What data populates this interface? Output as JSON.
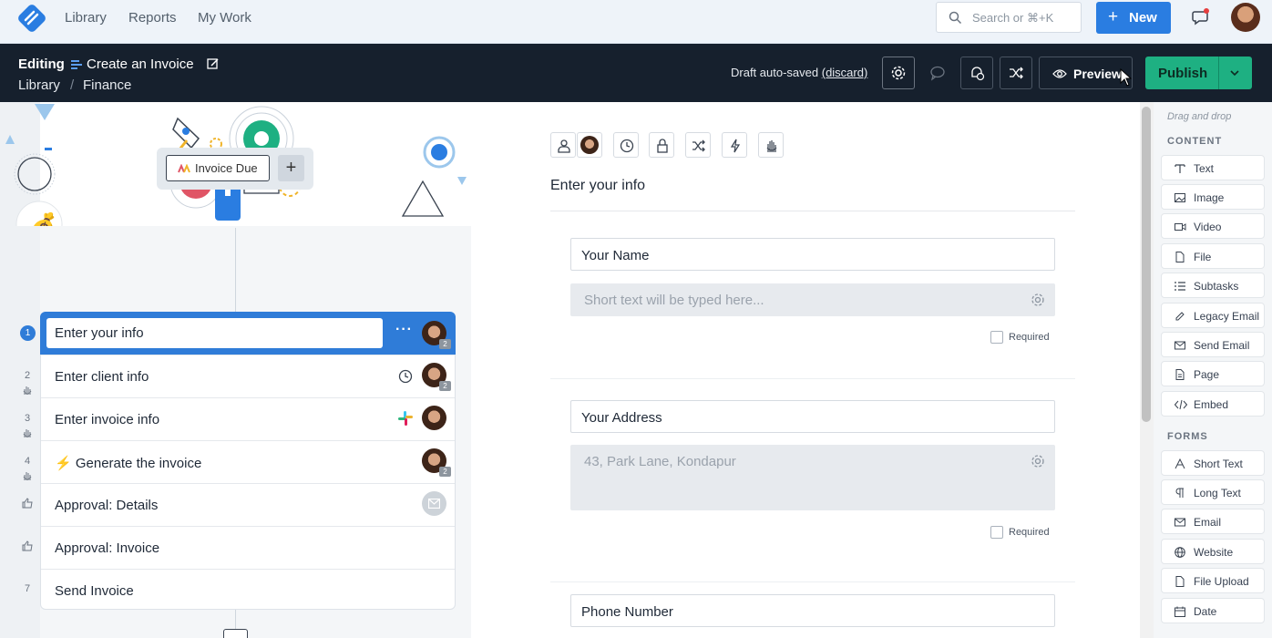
{
  "nav": {
    "links": [
      "Library",
      "Reports",
      "My Work"
    ],
    "search_placeholder": "Search or ⌘+K",
    "new_label": "New"
  },
  "editbar": {
    "editing_label": "Editing",
    "title": "Create an Invoice",
    "breadcrumb": [
      "Library",
      "Finance"
    ],
    "breadcrumb_sep": "/",
    "draft_text": "Draft auto-saved",
    "discard_label": "(discard)",
    "preview_label": "Preview",
    "publish_label": "Publish"
  },
  "workflow": {
    "trigger_label": "Invoice Due",
    "tasks": [
      {
        "num": "1",
        "name": "Enter your info",
        "assignees": "2"
      },
      {
        "num": "2",
        "name": "Enter client info",
        "assignees": "2"
      },
      {
        "num": "3",
        "name": "Enter invoice info"
      },
      {
        "num": "4",
        "name": "Generate the invoice",
        "prefix": "⚡",
        "assignees": "2"
      },
      {
        "num": "",
        "name": "Approval: Details"
      },
      {
        "num": "",
        "name": "Approval: Invoice"
      },
      {
        "num": "7",
        "name": "Send Invoice"
      }
    ]
  },
  "form": {
    "title": "Enter your info",
    "fields": [
      {
        "label": "Your Name",
        "placeholder": "Short text will be typed here...",
        "required_label": "Required"
      },
      {
        "label": "Your Address",
        "placeholder": "43, Park Lane, Kondapur",
        "required_label": "Required"
      },
      {
        "label": "Phone Number"
      }
    ]
  },
  "palette": {
    "hint": "Drag and drop",
    "content_heading": "CONTENT",
    "content_items": [
      "Text",
      "Image",
      "Video",
      "File",
      "Subtasks",
      "Legacy Email",
      "Send Email",
      "Page",
      "Embed"
    ],
    "forms_heading": "FORMS",
    "form_items": [
      "Short Text",
      "Long Text",
      "Email",
      "Website",
      "File Upload",
      "Date"
    ]
  },
  "colors": {
    "primary": "#2a7de1",
    "publish": "#1eb082",
    "dark_bar": "#16202d",
    "active_task": "#2f7cd8"
  }
}
